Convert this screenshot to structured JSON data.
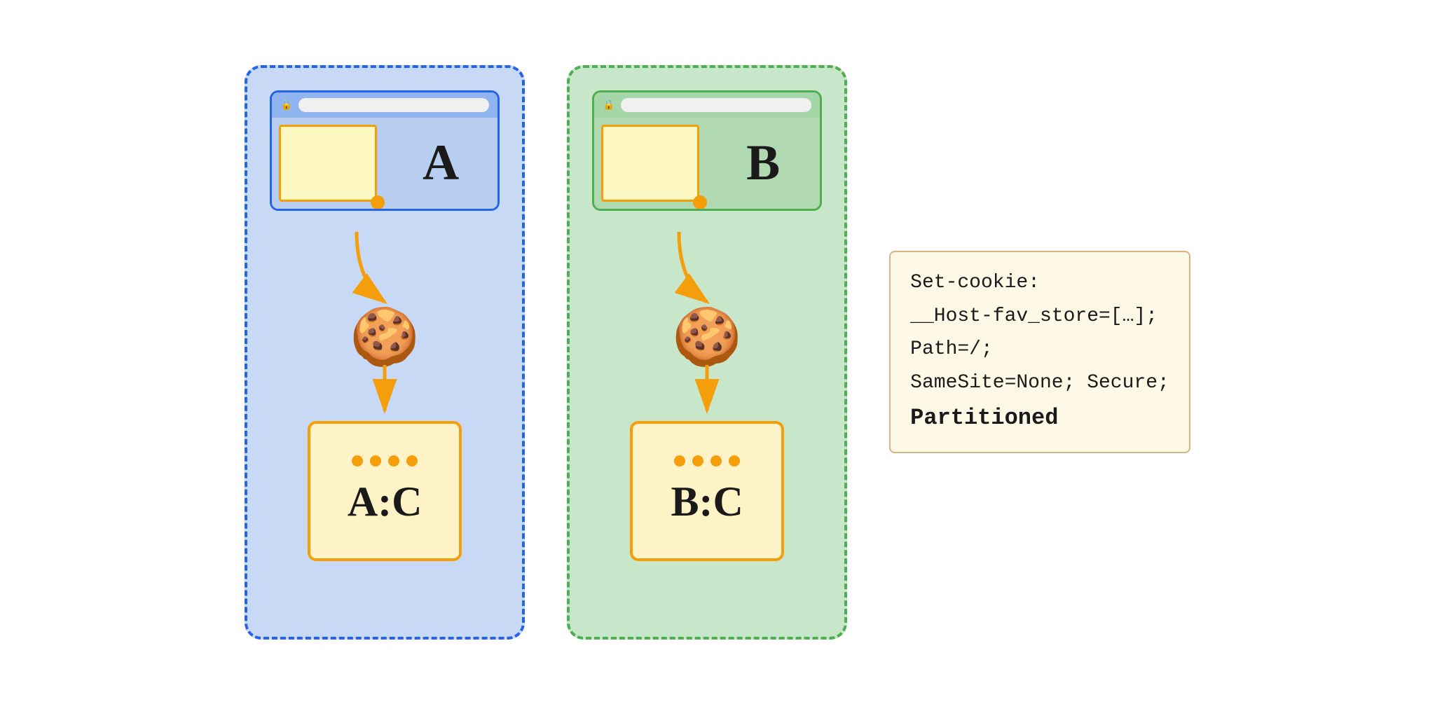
{
  "left_box": {
    "site_label": "A",
    "storage_label": "A:C",
    "box_color": "blue"
  },
  "right_box": {
    "site_label": "B",
    "storage_label": "B:C",
    "box_color": "green"
  },
  "code_lines": [
    "Set-cookie:",
    "__Host-fav_store=[…];",
    "Path=/;",
    "SameSite=None; Secure;",
    "Partitioned"
  ]
}
